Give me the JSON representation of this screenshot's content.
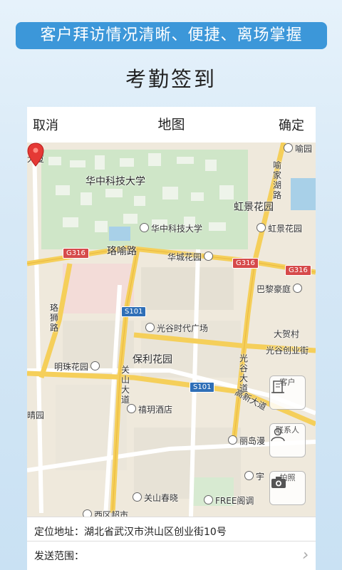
{
  "banner": {
    "text": "客户拜访情况清晰、便捷、离场掌握"
  },
  "heading": {
    "text": "考勤签到"
  },
  "topbar": {
    "cancel": "取消",
    "title": "地图",
    "confirm": "确定"
  },
  "map": {
    "labels": {
      "dasha": "大厦",
      "yudi": "喻园",
      "hust1": "华中科技大学",
      "hust2": "华中科技大学",
      "yujiahu": "喻家湖路",
      "hongjing1": "虹景花园",
      "hongjing2": "虹景花园",
      "luoyu": "珞喻路",
      "huacheng": "华城花园",
      "bali": "巴黎豪庭",
      "luoshi": "珞狮路",
      "guanggu_plaza": "光谷时代广场",
      "dahecun": "大贺村",
      "guanggu_chuangye": "光谷创业街",
      "mingzhu": "明珠花园",
      "baoli": "保利花园",
      "guanshan": "关山大道",
      "guanggu_dadao": "光谷大道",
      "gaoxin": "高新大道",
      "xiyue": "禧玥酒店",
      "lidao": "丽岛漫",
      "yuxx": "宇",
      "guanshan_chunxiao": "关山春晓",
      "free": "FREE阁调",
      "xiqu": "西区超市",
      "jingyuan": "晴园"
    },
    "shields": {
      "g316a": "G316",
      "g316b": "G316",
      "g316c": "G316",
      "s101a": "S101",
      "s101b": "S101"
    },
    "pin_color": "#e53935"
  },
  "side_buttons": {
    "customer": "客户",
    "contacts": "联系人",
    "photo": "拍照"
  },
  "address": {
    "label": "定位地址：湖北省武汉市洪山区创业街10号"
  },
  "send_range": {
    "label": "发送范围："
  }
}
